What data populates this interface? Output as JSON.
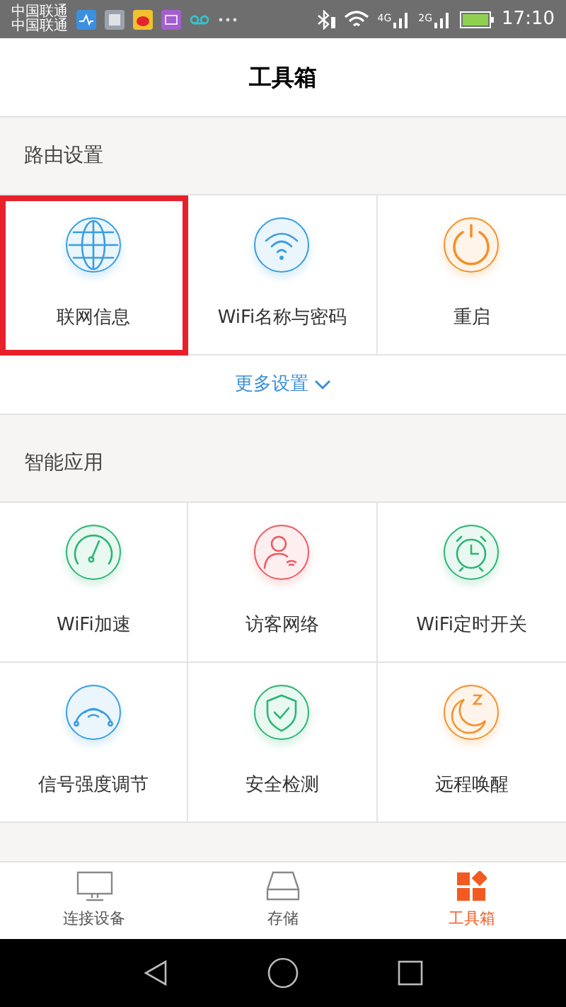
{
  "status_bar": {
    "carrier_lines": [
      "中国联通",
      "中国联通"
    ],
    "network_labels": [
      "4G",
      "2G"
    ],
    "time": "17:10"
  },
  "header": {
    "title": "工具箱"
  },
  "sections": [
    {
      "title": "路由设置",
      "items": [
        {
          "label": "联网信息",
          "kind": "globe",
          "color": "#3a9ee0",
          "highlighted": true
        },
        {
          "label": "WiFi名称与密码",
          "kind": "wifi",
          "color": "#3a9ee0",
          "highlighted": false
        },
        {
          "label": "重启",
          "kind": "power",
          "color": "#f5902a",
          "highlighted": false
        }
      ],
      "more": {
        "label": "更多设置"
      }
    },
    {
      "title": "智能应用",
      "items": [
        {
          "label": "WiFi加速",
          "kind": "gauge",
          "color": "#2bb673",
          "highlighted": false
        },
        {
          "label": "访客网络",
          "kind": "guest",
          "color": "#ef5a63",
          "highlighted": false
        },
        {
          "label": "WiFi定时开关",
          "kind": "alarm",
          "color": "#2bb673",
          "highlighted": false
        },
        {
          "label": "信号强度调节",
          "kind": "signal",
          "color": "#3a9ee0",
          "highlighted": false
        },
        {
          "label": "安全检测",
          "kind": "shield",
          "color": "#2bb673",
          "highlighted": false
        },
        {
          "label": "远程唤醒",
          "kind": "moon",
          "color": "#f5902a",
          "highlighted": false
        }
      ]
    }
  ],
  "tab_bar": [
    {
      "label": "连接设备",
      "kind": "monitor",
      "selected": false
    },
    {
      "label": "存储",
      "kind": "drive",
      "selected": false
    },
    {
      "label": "工具箱",
      "kind": "tools",
      "selected": true
    }
  ]
}
